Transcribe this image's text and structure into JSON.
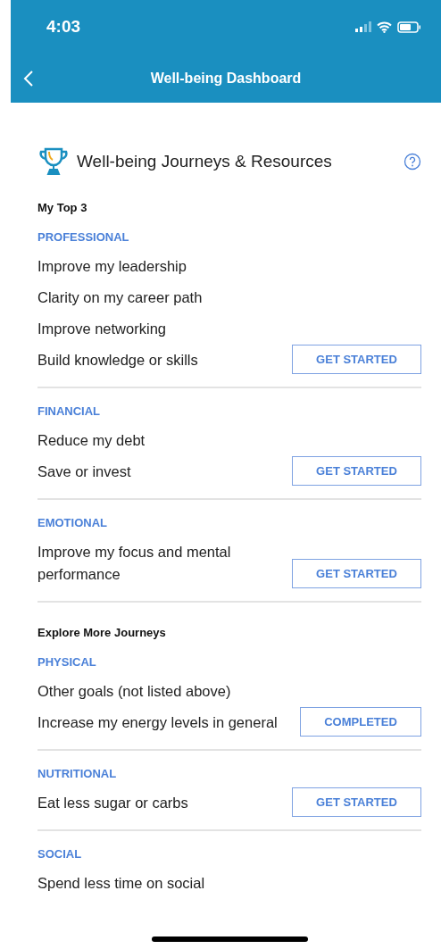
{
  "status_bar": {
    "time": "4:03"
  },
  "nav": {
    "title": "Well-being Dashboard"
  },
  "card": {
    "title": "Well-being Journeys & Resources",
    "groups": [
      {
        "heading": "My Top 3",
        "categories": [
          {
            "name": "PROFESSIONAL",
            "items": [
              "Improve my leadership",
              "Clarity on my career path",
              "Improve networking",
              "Build knowledge or skills"
            ],
            "button": {
              "label": "GET STARTED",
              "kind": "start"
            }
          },
          {
            "name": "FINANCIAL",
            "items": [
              "Reduce my debt",
              "Save or invest"
            ],
            "button": {
              "label": "GET STARTED",
              "kind": "start"
            }
          },
          {
            "name": "EMOTIONAL",
            "items": [
              "Improve my focus and mental performance"
            ],
            "button": {
              "label": "GET STARTED",
              "kind": "start"
            }
          }
        ]
      },
      {
        "heading": "Explore More Journeys",
        "categories": [
          {
            "name": "PHYSICAL",
            "items": [
              "Other goals (not listed above)",
              "Increase my energy levels in general"
            ],
            "button": {
              "label": "COMPLETED",
              "kind": "completed"
            }
          },
          {
            "name": "NUTRITIONAL",
            "items": [
              "Eat less sugar or carbs"
            ],
            "button": {
              "label": "GET STARTED",
              "kind": "start"
            }
          },
          {
            "name": "SOCIAL",
            "items": [
              "Spend less time on social"
            ]
          }
        ]
      }
    ]
  }
}
